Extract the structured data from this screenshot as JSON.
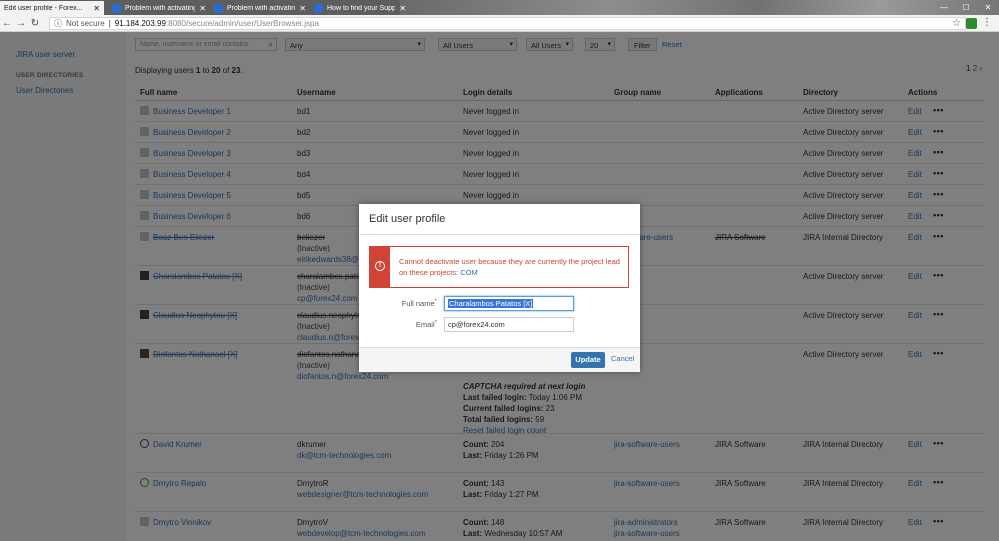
{
  "browser": {
    "tabs": [
      {
        "label": "Edit user profile - Forex..."
      },
      {
        "label": "Problem with activating..."
      },
      {
        "label": "Problem with activating..."
      },
      {
        "label": "How to find your Suppo..."
      }
    ],
    "not_secure": "Not secure",
    "url_host": "91.184.203.99",
    "url_path": ":8080/secure/admin/user/UserBrowser.jspa"
  },
  "sidebar": {
    "jira_user_server": "JIRA user server",
    "section_heading": "USER DIRECTORIES",
    "user_directories": "User Directories"
  },
  "filters": {
    "search_placeholder": "Name, username or email contains",
    "group_select": "Any",
    "app_select": "All Users",
    "dir_select": "All Users",
    "per_page": "20",
    "filter_button": "Filter",
    "reset_link": "Reset"
  },
  "summary": {
    "prefix": "Displaying users ",
    "from": "1",
    "to_word": " to ",
    "to": "20",
    "of_word": " of ",
    "total": "23",
    "suffix": "."
  },
  "pager": {
    "current": "1",
    "next": "2",
    "arrow": "›"
  },
  "table": {
    "headers": {
      "full_name": "Full name",
      "username": "Username",
      "login": "Login details",
      "group": "Group name",
      "applications": "Applications",
      "directory": "Directory",
      "actions": "Actions"
    },
    "rows": [
      {
        "name": "Business Developer 1",
        "username": "bd1",
        "login": "Never logged in",
        "directory": "Active Directory server",
        "edit": "Edit"
      },
      {
        "name": "Business Developer 2",
        "username": "bd2",
        "login": "Never logged in",
        "directory": "Active Directory server",
        "edit": "Edit"
      },
      {
        "name": "Business Developer 3",
        "username": "bd3",
        "login": "Never logged in",
        "directory": "Active Directory server",
        "edit": "Edit"
      },
      {
        "name": "Business Developer 4",
        "username": "bd4",
        "login": "Never logged in",
        "directory": "Active Directory server",
        "edit": "Edit"
      },
      {
        "name": "Business Developer 5",
        "username": "bd5",
        "login": "Never logged in",
        "directory": "Active Directory server",
        "edit": "Edit"
      },
      {
        "name": "Business Developer 6",
        "username": "bd6",
        "login": "",
        "directory": "Active Directory server",
        "edit": "Edit"
      },
      {
        "name": "Boaz Ben Eliezer",
        "username": "beliezer",
        "inactive": "(Inactive)",
        "email": "eirikedwards38@gm...",
        "group": "...software-users",
        "application": "JIRA Software",
        "directory": "JIRA Internal Directory",
        "edit": "Edit"
      },
      {
        "name": "Charalambos Patatos [X]",
        "username": "charalambos.patato...",
        "inactive": "(Inactive)",
        "email": "cp@forex24.com",
        "directory": "Active Directory server",
        "edit": "Edit"
      },
      {
        "name": "Claudius Neophytou [X]",
        "username": "claudius.neophytou...",
        "inactive": "(Inactive)",
        "email": "claudius.n@forex2...",
        "directory": "Active Directory server",
        "edit": "Edit"
      },
      {
        "name": "Diofantos Nathanael [X]",
        "username": "diofantos.nathanae...",
        "inactive": "(Inactive)",
        "email": "diofantos.n@forex24.com",
        "directory": "Active Directory server",
        "edit": "Edit",
        "captcha": "CAPTCHA required at next login",
        "last_failed_label": "Last failed login:",
        "last_failed": " Today 1:06 PM",
        "current_failed_label": "Current failed logins:",
        "current_failed": " 23",
        "total_failed_label": "Total failed logins:",
        "total_failed": " 59",
        "reset_failed": "Reset failed login count"
      },
      {
        "name": "David Krumer",
        "username": "dkrumer",
        "email": "dk@tcm-technologies.com",
        "count_label": "Count:",
        "count": " 204",
        "last_label": "Last:",
        "last": " Friday 1:26 PM",
        "group": "jira-software-users",
        "application": "JIRA Software",
        "directory": "JIRA Internal Directory",
        "edit": "Edit"
      },
      {
        "name": "Dmytro Repalo",
        "username": "DmytroR",
        "email": "webdesigner@tcm-technologies.com",
        "count_label": "Count:",
        "count": " 143",
        "last_label": "Last:",
        "last": " Friday 1:27 PM",
        "group": "jira-software-users",
        "application": "JIRA Software",
        "directory": "JIRA Internal Directory",
        "edit": "Edit"
      },
      {
        "name": "Dmytro Vinnikov",
        "username": "DmytroV",
        "email": "webdevelop@tcm-technologies.com",
        "count_label": "Count:",
        "count": " 148",
        "last_label": "Last:",
        "last": " Wednesday 10:57 AM",
        "group": "jira-administrators",
        "group2": "jira-software-users",
        "application": "JIRA Software",
        "directory": "JIRA Internal Directory",
        "edit": "Edit"
      }
    ]
  },
  "dialog": {
    "title": "Edit user profile",
    "error_text": "Cannot deactivate user because they are currently the project lead on these projects: ",
    "error_link": "COM",
    "full_name_label": "Full name",
    "full_name_value": "Charalambos Patatos [X]",
    "email_label": "Email",
    "email_value": "cp@forex24.com",
    "required_marker": "*",
    "update_button": "Update",
    "cancel_link": "Cancel"
  },
  "colors": {
    "link": "#3572b0",
    "error": "#d04437",
    "primary_button": "#3572b0"
  }
}
